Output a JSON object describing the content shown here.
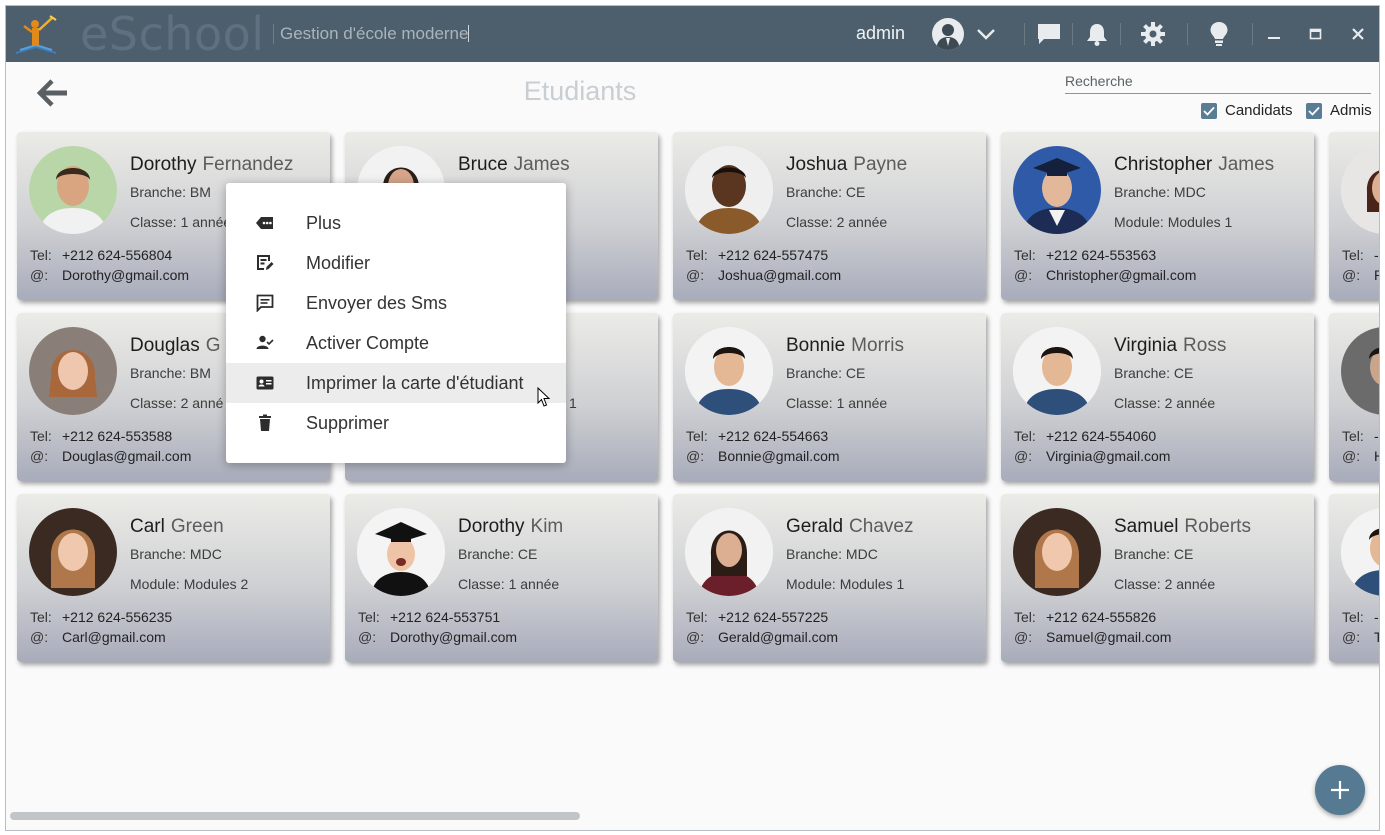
{
  "app": {
    "brand": "eSchool",
    "tagline": "Gestion d'école moderne",
    "username": "admin"
  },
  "page": {
    "title": "Etudiants"
  },
  "search": {
    "placeholder": "Recherche"
  },
  "filters": [
    {
      "label": "Candidats",
      "checked": true
    },
    {
      "label": "Admis",
      "checked": true
    }
  ],
  "labels": {
    "tel": "Tel:",
    "email": "@:"
  },
  "students": [
    {
      "first": "Dorothy",
      "last": "Fernandez",
      "line1": "Branche: BM",
      "line2": "Classe: 1  année",
      "tel": "+212 624-556804",
      "email": "Dorothy@gmail.com"
    },
    {
      "first": "Bruce",
      "last": "James",
      "line1": "",
      "line2": "",
      "tel": "",
      "email": ""
    },
    {
      "first": "Joshua",
      "last": "Payne",
      "line1": "Branche: CE",
      "line2": "Classe: 2  année",
      "tel": "+212 624-557475",
      "email": "Joshua@gmail.com"
    },
    {
      "first": "Christopher",
      "last": "James",
      "line1": "Branche: MDC",
      "line2": "Module: Modules 1",
      "tel": "+212 624-553563",
      "email": "Christopher@gmail.com"
    },
    {
      "first": "",
      "last": "",
      "line1": "",
      "line2": "",
      "tel": "-",
      "email": "P"
    },
    {
      "first": "Douglas",
      "last": "G",
      "line1": "Branche: BM",
      "line2": "Classe: 2  anné",
      "tel": "+212 624-553588",
      "email": "Douglas@gmail.com"
    },
    {
      "first": "",
      "last": "",
      "line1": "",
      "line2": "1",
      "tel": "",
      "email": ""
    },
    {
      "first": "Bonnie",
      "last": "Morris",
      "line1": "Branche: CE",
      "line2": "Classe: 1  année",
      "tel": "+212 624-554663",
      "email": "Bonnie@gmail.com"
    },
    {
      "first": "Virginia",
      "last": "Ross",
      "line1": "Branche: CE",
      "line2": "Classe: 2  année",
      "tel": "+212 624-554060",
      "email": "Virginia@gmail.com"
    },
    {
      "first": "",
      "last": "",
      "line1": "",
      "line2": "",
      "tel": "-",
      "email": "H"
    },
    {
      "first": "Carl",
      "last": "Green",
      "line1": "Branche: MDC",
      "line2": "Module: Modules 2",
      "tel": "+212 624-556235",
      "email": "Carl@gmail.com"
    },
    {
      "first": "Dorothy",
      "last": "Kim",
      "line1": "Branche: CE",
      "line2": "Classe: 1  année",
      "tel": "+212 624-553751",
      "email": "Dorothy@gmail.com"
    },
    {
      "first": "Gerald",
      "last": "Chavez",
      "line1": "Branche: MDC",
      "line2": "Module: Modules 1",
      "tel": "+212 624-557225",
      "email": "Gerald@gmail.com"
    },
    {
      "first": "Samuel",
      "last": "Roberts",
      "line1": "Branche: CE",
      "line2": "Classe: 2  année",
      "tel": "+212 624-555826",
      "email": "Samuel@gmail.com"
    },
    {
      "first": "",
      "last": "",
      "line1": "",
      "line2": "",
      "tel": "-",
      "email": "T"
    }
  ],
  "context_menu": {
    "items": [
      {
        "label": "Plus",
        "icon": "more-icon"
      },
      {
        "label": "Modifier",
        "icon": "edit-icon"
      },
      {
        "label": "Envoyer des Sms",
        "icon": "message-icon"
      },
      {
        "label": "Activer Compte",
        "icon": "user-check-icon"
      },
      {
        "label": "Imprimer la carte d'étudiant",
        "icon": "id-card-icon",
        "hovered": true
      },
      {
        "label": "Supprimer",
        "icon": "trash-icon"
      }
    ]
  },
  "colors": {
    "titlebar": "#4d5f6c",
    "accent": "#557a92",
    "checkbox": "#5a7d96"
  }
}
